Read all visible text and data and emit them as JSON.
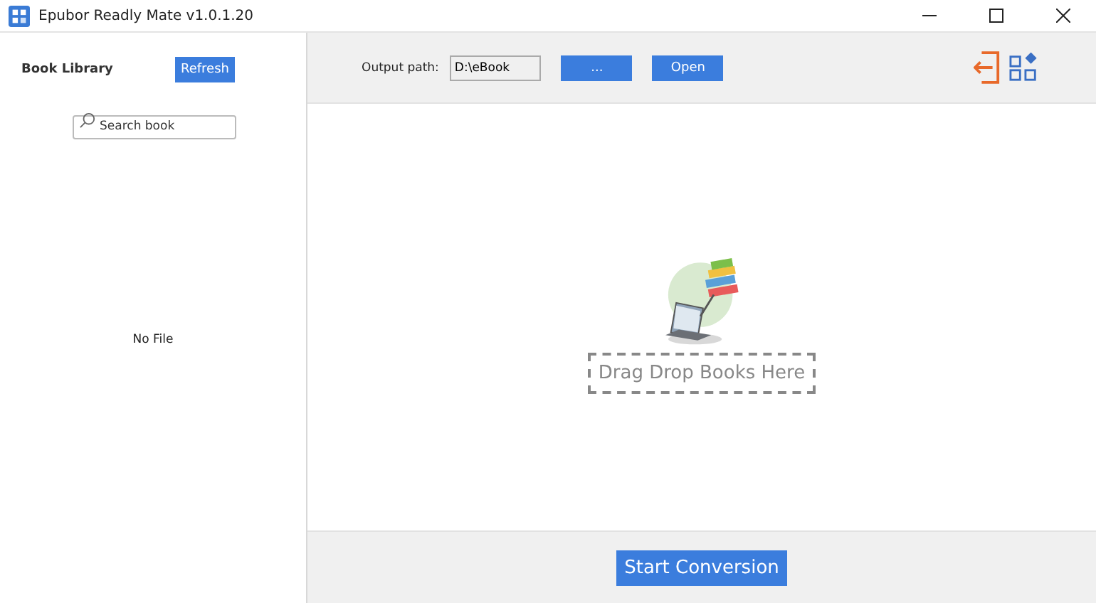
{
  "window": {
    "title": "Epubor Readly Mate v1.0.1.20"
  },
  "sidebar": {
    "title": "Book Library",
    "refresh_button": "Refresh",
    "search": {
      "placeholder": "Search book"
    },
    "empty_text": "No File"
  },
  "toolbar": {
    "output_label": "Output path:",
    "output_path": "D:\\eBook",
    "browse_button": "...",
    "open_button": "Open"
  },
  "drop_zone": {
    "text": "Drag Drop Books Here"
  },
  "start_button": "Start Conversion"
}
